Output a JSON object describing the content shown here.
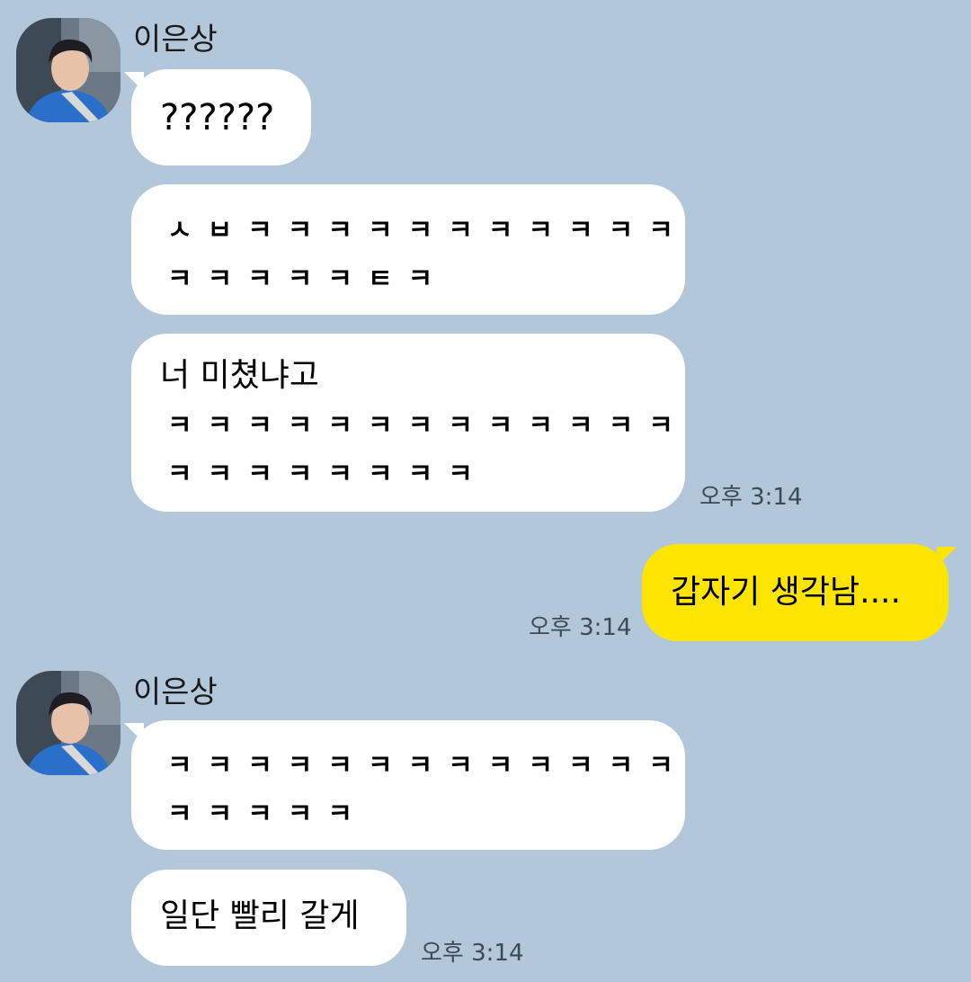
{
  "chat": {
    "sender_name": "이은상",
    "colors": {
      "background": "#b2c7da",
      "incoming_bubble": "#ffffff",
      "outgoing_bubble": "#fee500"
    },
    "group1": {
      "msg1": "??????",
      "msg2_line1": "ㅅㅂㅋㅋㅋㅋㅋㅋㅋㅋㅋㅋㅋ",
      "msg2_line2": "ㅋㅋㅋㅋㅋㅌㅋ",
      "msg3_line1": "너 미쳤냐고",
      "msg3_line2": "ㅋㅋㅋㅋㅋㅋㅋㅋㅋㅋㅋㅋㅋ",
      "msg3_line3": "ㅋㅋㅋㅋㅋㅋㅋㅋ",
      "time": "오후 3:14"
    },
    "outgoing": {
      "msg": "갑자기 생각남....",
      "time": "오후 3:14"
    },
    "group2": {
      "msg1_line1": "ㅋㅋㅋㅋㅋㅋㅋㅋㅋㅋㅋㅋㅋ",
      "msg1_line2": "ㅋㅋㅋㅋㅋ",
      "msg2": "일단 빨리 갈게",
      "time": "오후 3:14"
    }
  }
}
